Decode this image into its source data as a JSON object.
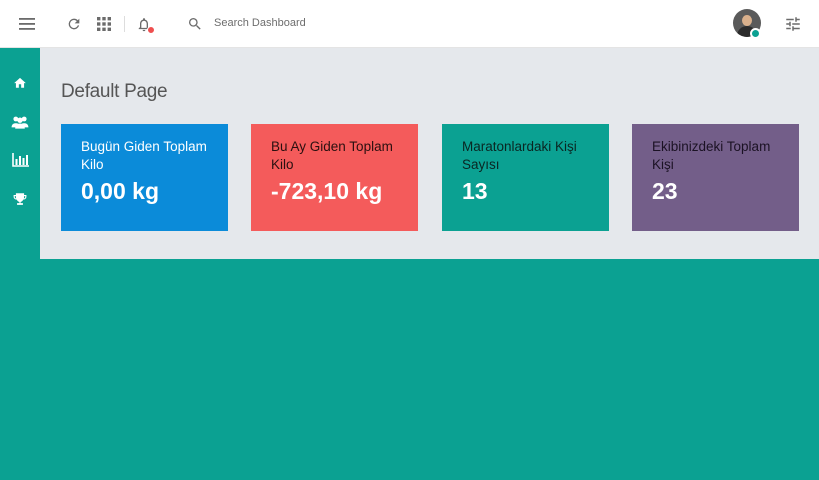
{
  "header": {
    "search_placeholder": "Search Dashboard",
    "icons": [
      "menu-icon",
      "refresh-icon",
      "apps-grid-icon",
      "bell-icon",
      "search-icon",
      "settings-sliders-icon"
    ]
  },
  "sidebar": {
    "items": [
      {
        "icon": "home-icon"
      },
      {
        "icon": "users-icon"
      },
      {
        "icon": "bar-chart-icon"
      },
      {
        "icon": "trophy-icon"
      }
    ]
  },
  "main": {
    "page_title": "Default Page",
    "cards": [
      {
        "label": "Bugün Giden Toplam Kilo",
        "value": "0,00 kg",
        "color": "#0b8bd9"
      },
      {
        "label": "Bu Ay Giden Toplam Kilo",
        "value": "-723,10 kg",
        "color": "#f45b5b"
      },
      {
        "label": "Maratonlardaki Kişi Sayısı",
        "value": "13",
        "color": "#0ba192"
      },
      {
        "label": "Ekibinizdeki Toplam Kişi",
        "value": "23",
        "color": "#735e89"
      }
    ]
  },
  "colors": {
    "accent": "#0ba192",
    "notification": "#ef4f4f",
    "content_bg": "#e5e8ec"
  }
}
